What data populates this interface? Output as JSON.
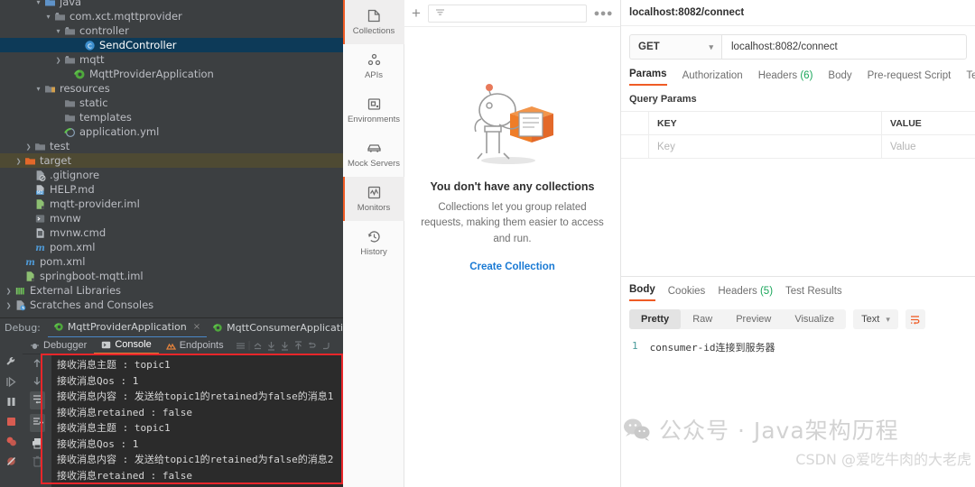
{
  "ide": {
    "tree": [
      {
        "indent": 3,
        "arrow": "down",
        "icon": "folder-source-icon",
        "label": "java",
        "state": "normal"
      },
      {
        "indent": 4,
        "arrow": "down",
        "icon": "package-icon",
        "label": "com.xct.mqttprovider",
        "state": "normal"
      },
      {
        "indent": 5,
        "arrow": "down",
        "icon": "package-icon",
        "label": "controller",
        "state": "normal"
      },
      {
        "indent": 7,
        "arrow": "none",
        "icon": "java-class-icon",
        "label": "SendController",
        "state": "selected"
      },
      {
        "indent": 5,
        "arrow": "right",
        "icon": "package-icon",
        "label": "mqtt",
        "state": "normal"
      },
      {
        "indent": 6,
        "arrow": "none",
        "icon": "spring-boot-icon",
        "label": "MqttProviderApplication",
        "state": "normal"
      },
      {
        "indent": 3,
        "arrow": "down",
        "icon": "folder-resources-icon",
        "label": "resources",
        "state": "normal"
      },
      {
        "indent": 5,
        "arrow": "none",
        "icon": "folder-icon",
        "label": "static",
        "state": "normal"
      },
      {
        "indent": 5,
        "arrow": "none",
        "icon": "folder-icon",
        "label": "templates",
        "state": "normal"
      },
      {
        "indent": 5,
        "arrow": "none",
        "icon": "yaml-spring-icon",
        "label": "application.yml",
        "state": "normal"
      },
      {
        "indent": 2,
        "arrow": "right",
        "icon": "folder-icon",
        "label": "test",
        "state": "normal"
      },
      {
        "indent": 1,
        "arrow": "right",
        "icon": "folder-target-icon",
        "label": "target",
        "state": "target"
      },
      {
        "indent": 2,
        "arrow": "none",
        "icon": "gitignore-icon",
        "label": ".gitignore",
        "state": "normal"
      },
      {
        "indent": 2,
        "arrow": "none",
        "icon": "markdown-icon",
        "label": "HELP.md",
        "state": "normal"
      },
      {
        "indent": 2,
        "arrow": "none",
        "icon": "iml-icon",
        "label": "mqtt-provider.iml",
        "state": "normal"
      },
      {
        "indent": 2,
        "arrow": "none",
        "icon": "shell-icon",
        "label": "mvnw",
        "state": "normal"
      },
      {
        "indent": 2,
        "arrow": "none",
        "icon": "cmd-icon",
        "label": "mvnw.cmd",
        "state": "normal"
      },
      {
        "indent": 2,
        "arrow": "none",
        "icon": "maven-icon",
        "label": "pom.xml",
        "state": "normal"
      },
      {
        "indent": 1,
        "arrow": "none",
        "icon": "maven-icon",
        "label": "pom.xml",
        "state": "normal"
      },
      {
        "indent": 1,
        "arrow": "none",
        "icon": "iml-icon",
        "label": "springboot-mqtt.iml",
        "state": "normal"
      },
      {
        "indent": 0,
        "arrow": "right",
        "icon": "external-libraries-icon",
        "label": "External Libraries",
        "state": "normal"
      },
      {
        "indent": 0,
        "arrow": "right",
        "icon": "scratches-icon",
        "label": "Scratches and Consoles",
        "state": "normal"
      }
    ],
    "debug": {
      "label": "Debug:",
      "tabs": [
        {
          "label": "MqttProviderApplication",
          "active": true,
          "closable": true
        },
        {
          "label": "MqttConsumerApplication",
          "active": false,
          "closable": false
        }
      ],
      "subtabs": [
        {
          "label": "Debugger",
          "active": false,
          "icon": "debugger-icon"
        },
        {
          "label": "Console",
          "active": true,
          "icon": "console-icon"
        },
        {
          "label": "Endpoints",
          "active": false,
          "icon": "endpoints-icon"
        }
      ]
    },
    "console_lines": [
      "接收消息主题 :  topic1",
      "接收消息Qos :  1",
      "接收消息内容 :  发送给topic1的retained为false的消息1",
      "接收消息retained :  false",
      "接收消息主题 :  topic1",
      "接收消息Qos :  1",
      "接收消息内容 :  发送给topic1的retained为false的消息2",
      "接收消息retained :  false"
    ],
    "highlight_color": "#e8262a"
  },
  "postman": {
    "rail": [
      {
        "label": "Collections",
        "icon": "collections-icon",
        "active": true
      },
      {
        "label": "APIs",
        "icon": "apis-icon",
        "active": false
      },
      {
        "label": "Environments",
        "icon": "environments-icon",
        "active": false
      },
      {
        "label": "Mock Servers",
        "icon": "mock-servers-icon",
        "active": false
      },
      {
        "label": "Monitors",
        "icon": "monitors-icon",
        "active": true
      },
      {
        "label": "History",
        "icon": "history-icon",
        "active": false
      }
    ],
    "collections": {
      "add_label": "+",
      "filter_placeholder": "",
      "more_label": "●●●",
      "empty_title": "You don't have any collections",
      "empty_text": "Collections let you group related requests, making them easier to access and run.",
      "create_label": "Create Collection"
    },
    "request": {
      "title": "localhost:8082/connect",
      "method": "GET",
      "url": "localhost:8082/connect",
      "tabs": [
        {
          "label": "Params",
          "active": true,
          "count": ""
        },
        {
          "label": "Authorization",
          "active": false,
          "count": ""
        },
        {
          "label": "Headers",
          "active": false,
          "count": "(6)"
        },
        {
          "label": "Body",
          "active": false,
          "count": ""
        },
        {
          "label": "Pre-request Script",
          "active": false,
          "count": ""
        },
        {
          "label": "Tests",
          "active": false,
          "count": ""
        }
      ],
      "query_params_label": "Query Params",
      "table": {
        "headers": [
          "KEY",
          "VALUE"
        ],
        "rows": [
          [
            "Key",
            "Value"
          ]
        ]
      }
    },
    "response": {
      "tabs": [
        {
          "label": "Body",
          "active": true,
          "count": ""
        },
        {
          "label": "Cookies",
          "active": false,
          "count": ""
        },
        {
          "label": "Headers",
          "active": false,
          "count": "(5)"
        },
        {
          "label": "Test Results",
          "active": false,
          "count": ""
        }
      ],
      "views": [
        {
          "label": "Pretty",
          "active": true
        },
        {
          "label": "Raw",
          "active": false
        },
        {
          "label": "Preview",
          "active": false
        },
        {
          "label": "Visualize",
          "active": false
        }
      ],
      "format": "Text",
      "body": {
        "line_no": "1",
        "text": "consumer-id连接到服务器"
      }
    },
    "accent_color": "#ef5b25",
    "link_color": "#1a7ad4"
  },
  "watermark": {
    "line1": "公众号 · Java架构历程",
    "line2": "CSDN @爱吃牛肉的大老虎"
  }
}
